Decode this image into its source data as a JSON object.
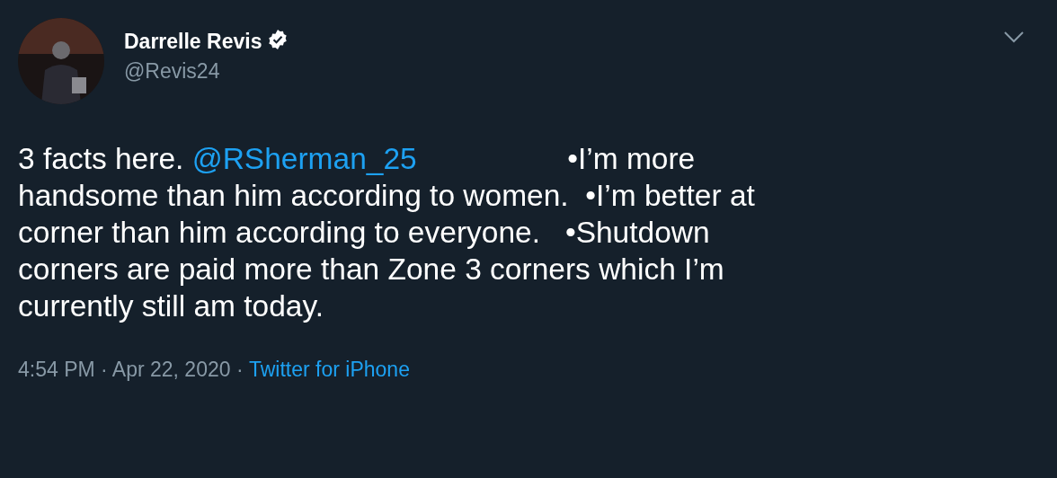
{
  "author": {
    "name": "Darrelle Revis",
    "verified": true,
    "handle": "@Revis24"
  },
  "body": [
    {
      "kind": "text",
      "text": "3 facts here. "
    },
    {
      "kind": "mention",
      "text": "@RSherman_25"
    },
    {
      "kind": "text",
      "text": "                  •I’m more\nhandsome than him according to women.  •I’m better at\ncorner than him according to everyone.   •Shutdown\ncorners are paid more than Zone 3 corners which I’m\ncurrently still am today."
    }
  ],
  "footer": {
    "timestamp": "4:54 PM · Apr 22, 2020 · ",
    "source": "Twitter for iPhone"
  }
}
